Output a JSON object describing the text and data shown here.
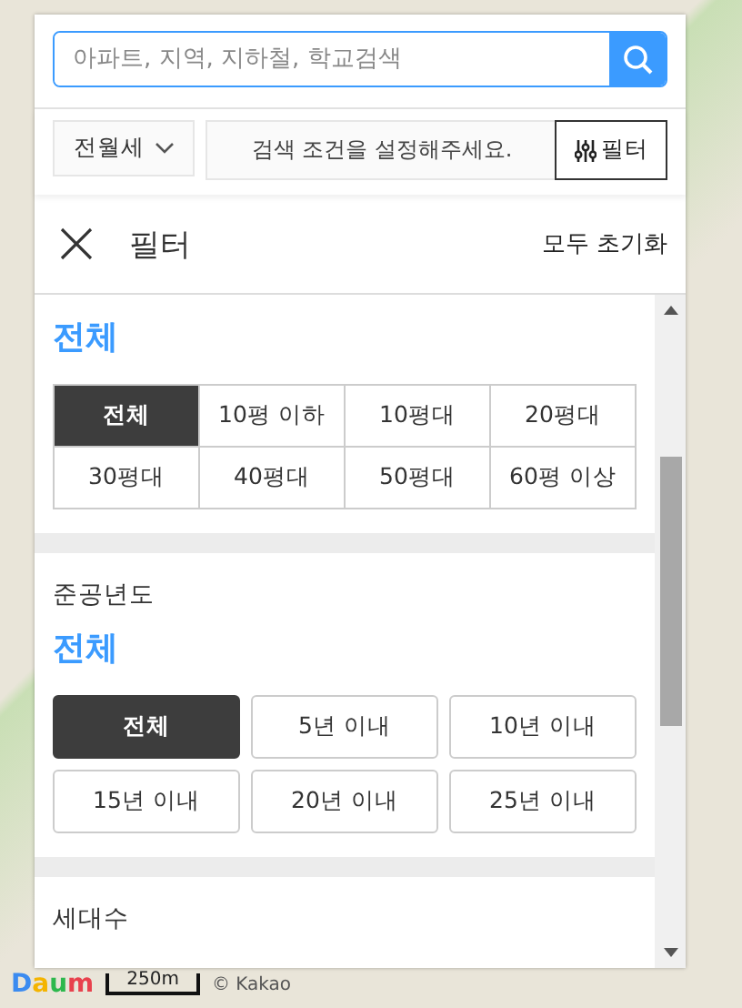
{
  "search": {
    "placeholder": "아파트, 지역, 지하철, 학교검색"
  },
  "toolbar": {
    "deal_type": "전월세",
    "condition": "검색 조건을 설정해주세요.",
    "filter_button": "필터"
  },
  "filter_header": {
    "title": "필터",
    "reset": "모두 초기화"
  },
  "sections": [
    {
      "kind": "grid",
      "value": "전체",
      "options": [
        {
          "label": "전체",
          "selected": true
        },
        {
          "label": "10평 이하",
          "selected": false
        },
        {
          "label": "10평대",
          "selected": false
        },
        {
          "label": "20평대",
          "selected": false
        },
        {
          "label": "30평대",
          "selected": false
        },
        {
          "label": "40평대",
          "selected": false
        },
        {
          "label": "50평대",
          "selected": false
        },
        {
          "label": "60평 이상",
          "selected": false
        }
      ]
    },
    {
      "kind": "buttons",
      "label": "준공년도",
      "value": "전체",
      "options": [
        {
          "label": "전체",
          "selected": true
        },
        {
          "label": "5년 이내",
          "selected": false
        },
        {
          "label": "10년 이내",
          "selected": false
        },
        {
          "label": "15년 이내",
          "selected": false
        },
        {
          "label": "20년 이내",
          "selected": false
        },
        {
          "label": "25년 이내",
          "selected": false
        }
      ]
    },
    {
      "kind": "buttons",
      "label": "세대수"
    }
  ],
  "map": {
    "logo": "Daum",
    "scale": "250m",
    "copyright": "© Kakao"
  }
}
